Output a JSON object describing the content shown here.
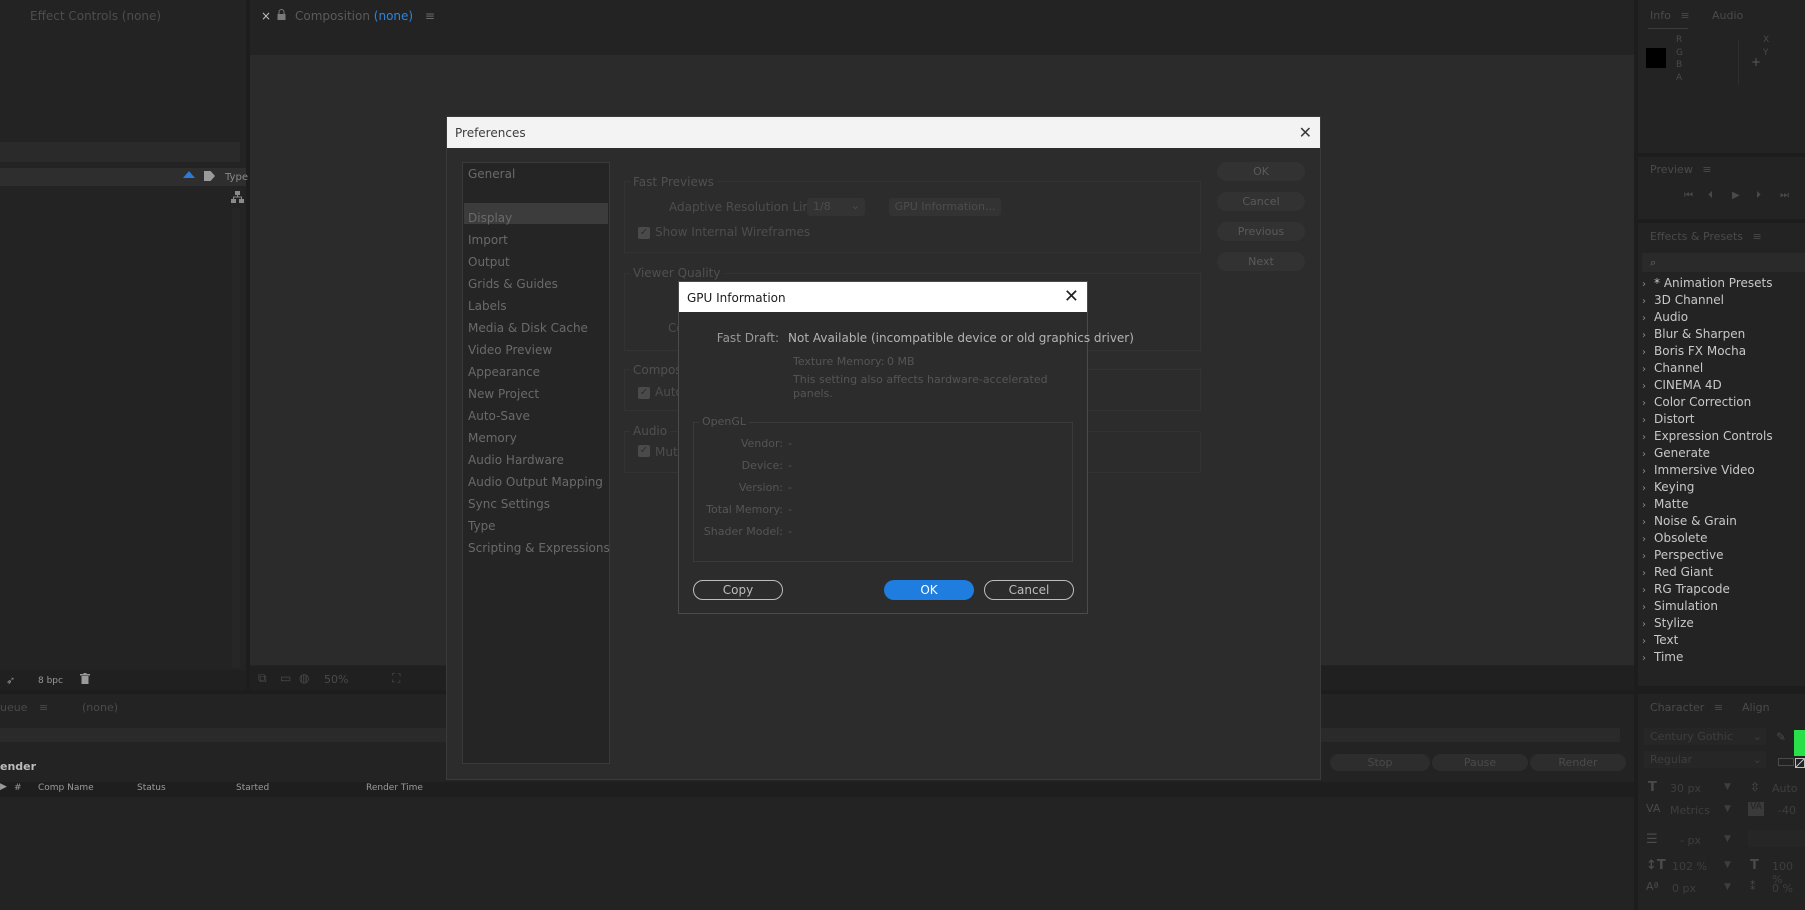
{
  "effect_controls": {
    "title": "Effect Controls (none)",
    "type_label": "Type",
    "bpc": "8 bpc"
  },
  "composition": {
    "close": "×",
    "title": "Composition",
    "title_accent": "(none)",
    "zoom": "50%"
  },
  "info_panel": {
    "tab_info": "Info",
    "tab_audio": "Audio",
    "rgba": [
      "R",
      "G",
      "B",
      "A"
    ],
    "xy": [
      "X",
      "Y"
    ],
    "plus": "+"
  },
  "preview_panel": {
    "title": "Preview"
  },
  "effects_presets": {
    "title": "Effects & Presets",
    "search_icon": "search-icon",
    "items": [
      "* Animation Presets",
      "3D Channel",
      "Audio",
      "Blur & Sharpen",
      "Boris FX Mocha",
      "Channel",
      "CINEMA 4D",
      "Color Correction",
      "Distort",
      "Expression Controls",
      "Generate",
      "Immersive Video",
      "Keying",
      "Matte",
      "Noise & Grain",
      "Obsolete",
      "Perspective",
      "Red Giant",
      "RG Trapcode",
      "Simulation",
      "Stylize",
      "Text",
      "Time"
    ]
  },
  "render_queue": {
    "tab": "ueue",
    "comp": "(none)",
    "render_label": "ender",
    "buttons": {
      "stop": "Stop",
      "pause": "Pause",
      "render": "Render"
    },
    "columns": [
      "#",
      "Comp Name",
      "Status",
      "Started",
      "Render Time"
    ]
  },
  "character": {
    "tab": "Character",
    "tab2": "Align",
    "font": "Century Gothic",
    "style": "Regular",
    "size": "30 px",
    "size_right": "Auto",
    "kerning": "Metrics",
    "tracking": "-40",
    "leading": "- px",
    "vscale": "102 %",
    "hscale": "100 %",
    "baseline": "0 px",
    "tsume": "0 %"
  },
  "preferences": {
    "title": "Preferences",
    "categories": [
      "General",
      "",
      "Display",
      "Import",
      "Output",
      "Grids & Guides",
      "Labels",
      "Media & Disk Cache",
      "Video Preview",
      "Appearance",
      "New Project",
      "Auto-Save",
      "Memory",
      "Audio Hardware",
      "Audio Output Mapping",
      "Sync Settings",
      "Type",
      "Scripting & Expressions"
    ],
    "buttons": {
      "ok": "OK",
      "cancel": "Cancel",
      "previous": "Previous",
      "next": "Next"
    },
    "fast_previews": {
      "label": "Fast Previews",
      "adaptive_label": "Adaptive Resolution Limit:",
      "adaptive_value": "1/8",
      "gpu_button": "GPU Information...",
      "wireframes": "Show Internal Wireframes"
    },
    "viewer_quality": {
      "label": "Viewer Quality",
      "co": "Co"
    },
    "composition": {
      "label": "Composi",
      "auto": "Auto"
    },
    "audio": {
      "label": "Audio",
      "mute": "Mute"
    }
  },
  "gpu_dialog": {
    "title": "GPU Information",
    "fast_draft_label": "Fast Draft:",
    "fast_draft_value": "Not Available (incompatible device or old graphics driver)",
    "texture_label": "Texture Memory:",
    "texture_value": "0 MB",
    "note_line1": "This setting also affects hardware-accelerated",
    "note_line2": "panels.",
    "opengl_label": "OpenGL",
    "opengl": [
      {
        "label": "Vendor:",
        "value": "-"
      },
      {
        "label": "Device:",
        "value": "-"
      },
      {
        "label": "Version:",
        "value": "-"
      },
      {
        "label": "Total Memory:",
        "value": "-"
      },
      {
        "label": "Shader Model:",
        "value": "-"
      }
    ],
    "copy": "Copy",
    "ok": "OK",
    "cancel": "Cancel"
  }
}
